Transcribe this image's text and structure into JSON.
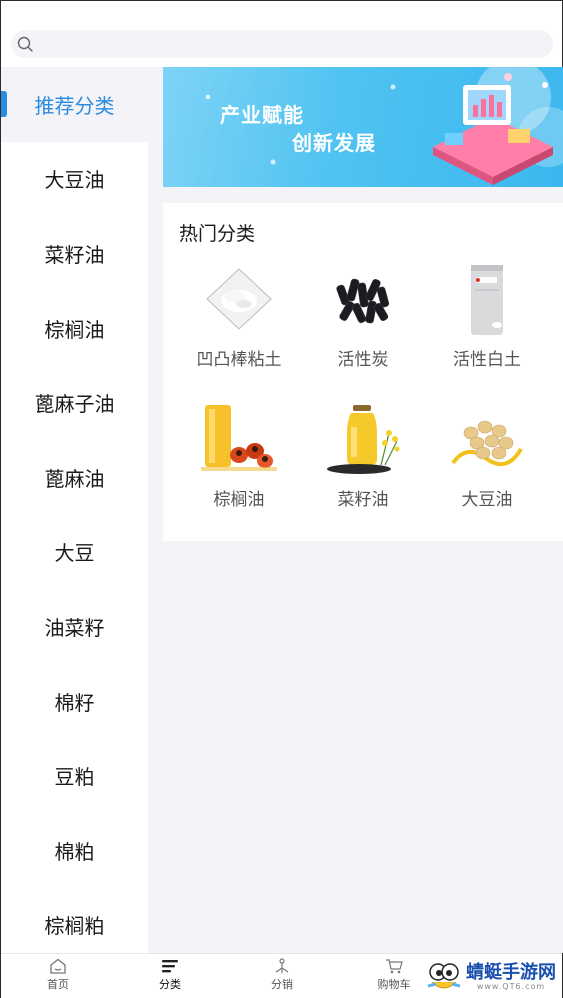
{
  "search": {
    "placeholder": "",
    "value": ""
  },
  "sidebar": {
    "items": [
      {
        "label": "推荐分类",
        "active": true
      },
      {
        "label": "大豆油"
      },
      {
        "label": "菜籽油"
      },
      {
        "label": "棕榈油"
      },
      {
        "label": "蓖麻子油"
      },
      {
        "label": "蓖麻油"
      },
      {
        "label": "大豆"
      },
      {
        "label": "油菜籽"
      },
      {
        "label": "棉籽"
      },
      {
        "label": "豆粕"
      },
      {
        "label": "棉粕"
      },
      {
        "label": "棕榈粕"
      }
    ]
  },
  "banner": {
    "line1": "产业赋能",
    "line2": "创新发展"
  },
  "hot": {
    "title": "热门分类",
    "items": [
      {
        "label": "凹凸棒粘土",
        "icon": "clay-powder-image"
      },
      {
        "label": "活性炭",
        "icon": "activated-carbon-image"
      },
      {
        "label": "活性白土",
        "icon": "bleaching-earth-bag-image"
      },
      {
        "label": "棕榈油",
        "icon": "palm-oil-image"
      },
      {
        "label": "菜籽油",
        "icon": "rapeseed-oil-image"
      },
      {
        "label": "大豆油",
        "icon": "soybean-oil-image"
      }
    ]
  },
  "tabbar": {
    "tabs": [
      {
        "label": "首页",
        "icon": "home-icon"
      },
      {
        "label": "分类",
        "icon": "category-icon",
        "active": true
      },
      {
        "label": "分销",
        "icon": "distribution-icon"
      },
      {
        "label": "购物车",
        "icon": "cart-icon"
      }
    ]
  },
  "watermark": {
    "text": "蜻蜓手游网",
    "url": "www.QT6.com"
  },
  "colors": {
    "accent": "#2a8be0",
    "background": "#f4f4f8"
  }
}
